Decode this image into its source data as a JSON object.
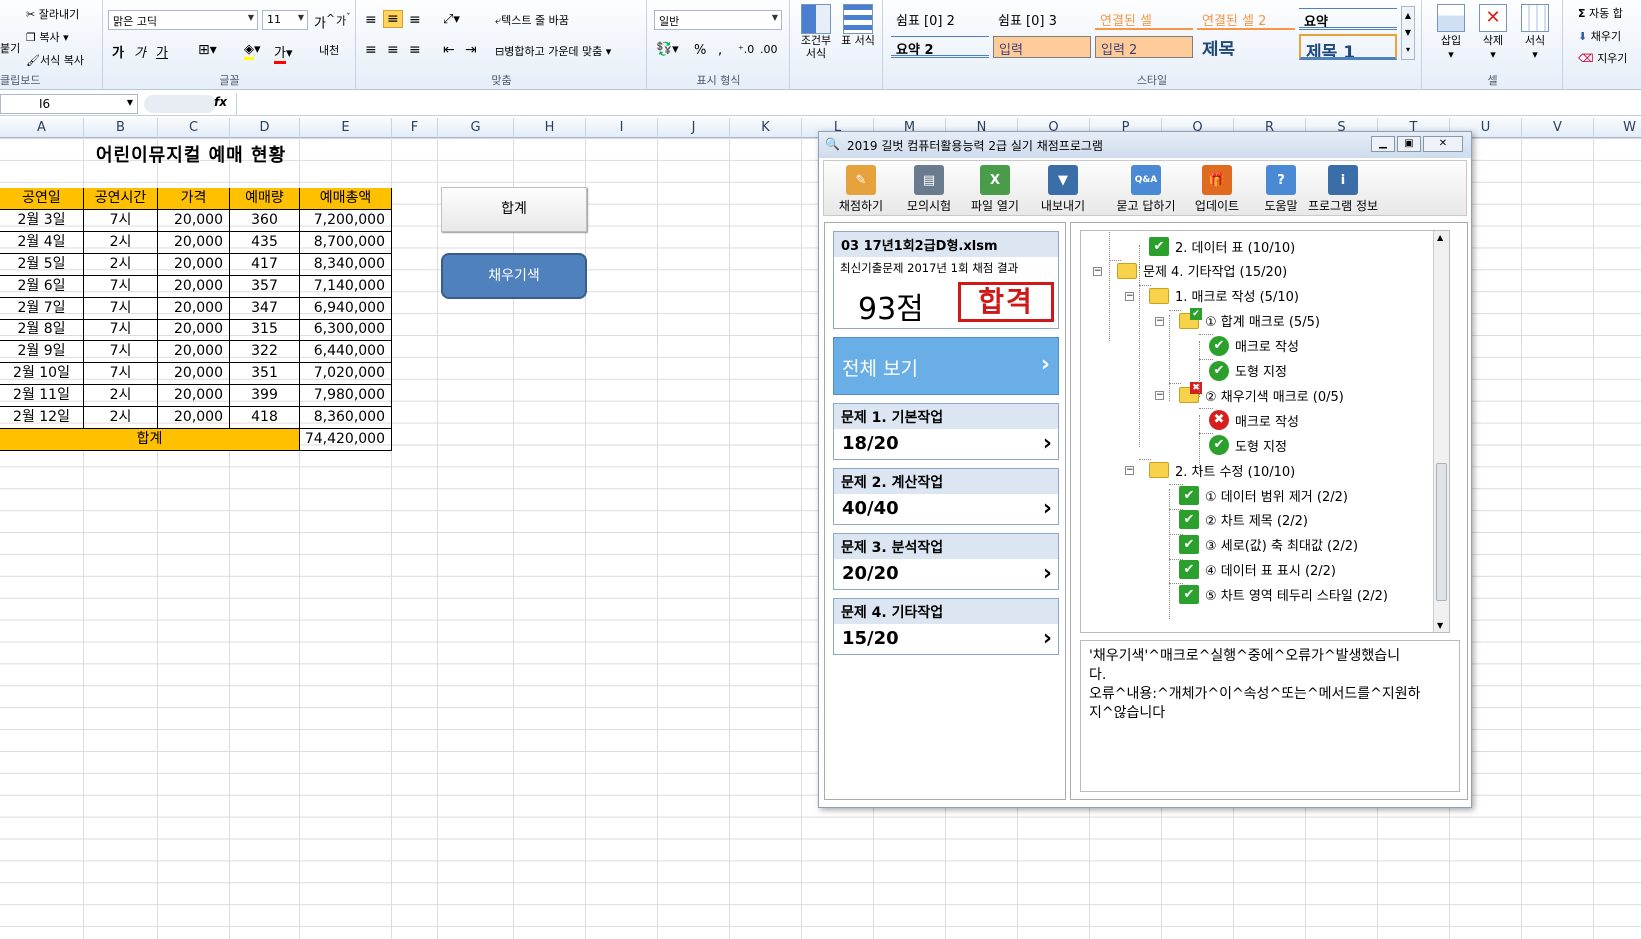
{
  "ribbon": {
    "clipboard": {
      "paste": "붙기",
      "cut": "잘라내기",
      "copy": "복사",
      "format_painter": "서식 복사",
      "label": "클립보드"
    },
    "font": {
      "name": "맑은 고딕",
      "size": "11",
      "bold": "가",
      "italic": "가",
      "underline": "가",
      "label": "글꼴",
      "color_label": "가",
      "phonetic": "내천"
    },
    "align": {
      "wrap": "텍스트 줄 바꿈",
      "merge": "병합하고 가운데 맞춤",
      "label": "맞춤"
    },
    "number": {
      "format": "일반",
      "label": "표시 형식"
    },
    "conditional": {
      "label": "조건부 서식"
    },
    "table": {
      "label": "표 서식"
    },
    "styles": {
      "label": "스타일",
      "items": [
        "쉼표 [0] 2",
        "쉼표 [0] 3",
        "연결된 셀",
        "연결된 셀 2",
        "요약",
        "요약 2",
        "입력",
        "입력 2",
        "제목",
        "제목 1"
      ]
    },
    "cells": {
      "insert": "삽입",
      "delete": "삭제",
      "format": "서식",
      "label": "셀"
    },
    "editing": {
      "autosum": "자동 합",
      "fill": "채우기",
      "clear": "지우기"
    }
  },
  "formula_bar": {
    "name_box": "I6",
    "fx": "fx",
    "content": ""
  },
  "columns": [
    "A",
    "B",
    "C",
    "D",
    "E",
    "F",
    "G",
    "H",
    "I",
    "J",
    "K",
    "L",
    "M",
    "N",
    "O",
    "P",
    "Q",
    "R",
    "S",
    "T",
    "U",
    "V",
    "W"
  ],
  "sheet": {
    "title": "어린이뮤지컬 예매 현황",
    "headers": [
      "공연일",
      "공연시간",
      "가격",
      "예매량",
      "예매총액"
    ],
    "rows": [
      [
        "2월 3일",
        "7시",
        "20,000",
        "360",
        "7,200,000"
      ],
      [
        "2월 4일",
        "2시",
        "20,000",
        "435",
        "8,700,000"
      ],
      [
        "2월 5일",
        "2시",
        "20,000",
        "417",
        "8,340,000"
      ],
      [
        "2월 6일",
        "7시",
        "20,000",
        "357",
        "7,140,000"
      ],
      [
        "2월 7일",
        "7시",
        "20,000",
        "347",
        "6,940,000"
      ],
      [
        "2월 8일",
        "7시",
        "20,000",
        "315",
        "6,300,000"
      ],
      [
        "2월 9일",
        "7시",
        "20,000",
        "322",
        "6,440,000"
      ],
      [
        "2월 10일",
        "7시",
        "20,000",
        "351",
        "7,020,000"
      ],
      [
        "2월 11일",
        "2시",
        "20,000",
        "399",
        "7,980,000"
      ],
      [
        "2월 12일",
        "2시",
        "20,000",
        "418",
        "8,360,000"
      ]
    ],
    "total_label": "합계",
    "total_value": "74,420,000",
    "btn_sum": "합계",
    "btn_fill": "채우기색"
  },
  "dialog": {
    "title": "2019 길벗 컴퓨터활용능력 2급 실기 채점프로그램",
    "tools": [
      "채점하기",
      "모의시험",
      "파일 열기",
      "내보내기",
      "묻고 답하기",
      "업데이트",
      "도움말",
      "프로그램 정보"
    ],
    "file": "03 17년1회2급D형.xlsm",
    "subtitle": "최신기출문제 2017년 1회 채점 결과",
    "score": "93점",
    "stamp": "합격",
    "view_all": "전체 보기",
    "sections": [
      {
        "title": "문제 1. 기본작업",
        "score": "18/20"
      },
      {
        "title": "문제 2. 계산작업",
        "score": "40/40"
      },
      {
        "title": "문제 3. 분석작업",
        "score": "20/20"
      },
      {
        "title": "문제 4. 기타작업",
        "score": "15/20"
      }
    ],
    "tree": [
      "2. 데이터 표 (10/10)",
      "문제 4. 기타작업 (15/20)",
      "1. 매크로 작성 (5/10)",
      "① 합계 매크로 (5/5)",
      "매크로 작성",
      "도형 지정",
      "② 채우기색 매크로 (0/5)",
      "매크로 작성",
      "도형 지정",
      "2. 차트 수정 (10/10)",
      "① 데이터 범위 제거 (2/2)",
      "② 차트 제목 (2/2)",
      "③ 세로(값) 축 최대값 (2/2)",
      "④ 데이터 표 표시 (2/2)",
      "⑤ 차트 영역 테두리 스타일 (2/2)"
    ],
    "message": "'채우기색'^매크로^실행^중에^오류가^발생했습니다.오류^내용:^개체가^이^속성^또는^메서드를^지원하지^않습니다",
    "message_line1": "'채우기색'^매크로^실행^중에^오류가^발생했습니",
    "message_line2": "다.",
    "message_line3": "오류^내용:^개체가^이^속성^또는^메서드를^지원하",
    "message_line4": "지^않습니다"
  }
}
